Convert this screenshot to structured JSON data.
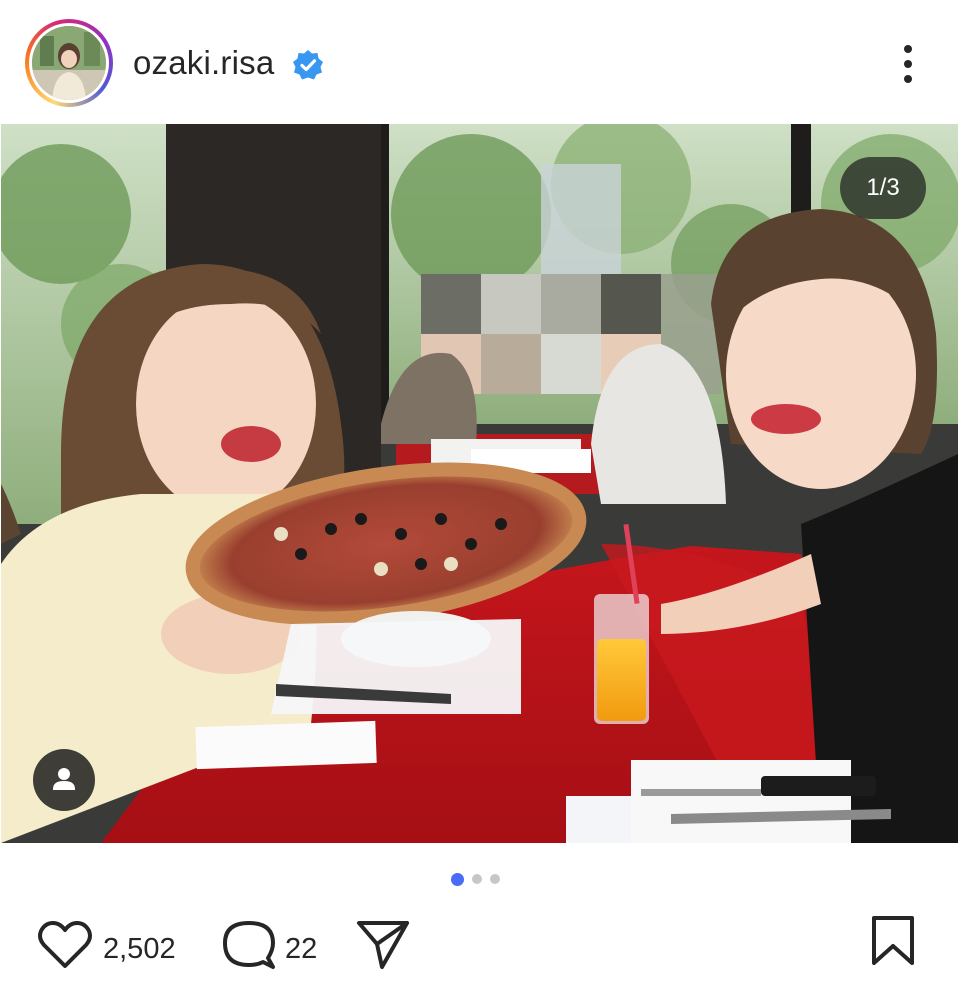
{
  "post": {
    "username": "ozaki.risa",
    "verified": true,
    "carousel_counter": "1/3",
    "carousel_total": 3,
    "carousel_index": 1
  },
  "actions": {
    "likes": "2,502",
    "comments": "22"
  },
  "icons": {
    "more": "more-vertical-icon",
    "verified": "verified-badge-icon",
    "tag": "user-tag-icon",
    "like": "heart-icon",
    "comment": "comment-icon",
    "share": "send-icon",
    "save": "bookmark-icon"
  },
  "colors": {
    "verified_blue": "#3897f0",
    "active_dot": "#4a6cf7",
    "inactive_dot": "#c7c7c7",
    "text": "#262626"
  }
}
